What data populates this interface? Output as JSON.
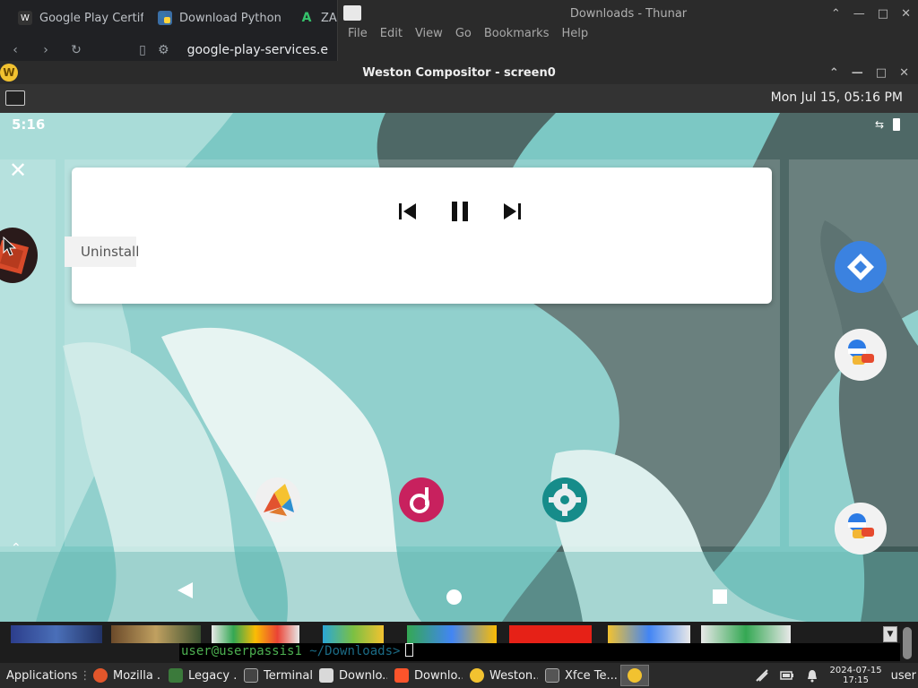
{
  "browser": {
    "tabs": [
      {
        "favicon": "W",
        "label": "Google Play Certific"
      },
      {
        "favicon": "python-icon",
        "label": "Download Python | P"
      },
      {
        "favicon": "A",
        "label": "ZA"
      }
    ],
    "url": "google-play-services.e"
  },
  "thunar": {
    "title": "Downloads - Thunar",
    "menu": [
      "File",
      "Edit",
      "View",
      "Go",
      "Bookmarks",
      "Help"
    ]
  },
  "weston": {
    "title": "Weston Compositor - screen0",
    "panel_clock": "Mon Jul 15, 05:16 PM"
  },
  "android": {
    "status_time": "5:16",
    "uninstall_label": "Uninstall",
    "media_controls": [
      "skip-previous",
      "pause",
      "skip-next"
    ]
  },
  "terminal": {
    "prompt_user": "user@userpassis1",
    "prompt_path": "~/Downloads>"
  },
  "taskbar": {
    "applications": "Applications",
    "tasks": [
      {
        "label": "Mozilla ...",
        "color": "#e2562b"
      },
      {
        "label": "Legacy ...",
        "color": "#3b7a3b"
      },
      {
        "label": "Terminal",
        "color": "#444444"
      },
      {
        "label": "Downlo...",
        "color": "#d9d9d9"
      },
      {
        "label": "Downlo...",
        "color": "#fb542b"
      },
      {
        "label": "Weston...",
        "color": "#f2c230"
      },
      {
        "label": "Xfce Te...",
        "color": "#555555"
      }
    ],
    "date": "2024-07-15",
    "time": "17:15",
    "user": "user"
  },
  "colors": {
    "android_teal": "#7cc8c4",
    "weston_yellow": "#f2c230",
    "terminal_green": "#4caf50"
  }
}
